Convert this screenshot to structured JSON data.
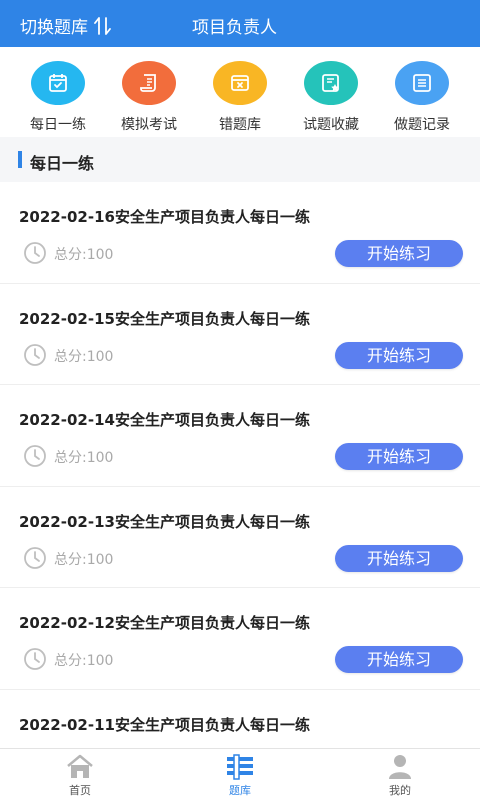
{
  "header": {
    "switch_label": "切换题库",
    "title": "项目负责人"
  },
  "quick_actions": [
    {
      "label": "每日一练",
      "icon": "calendar-check-icon",
      "color": "#25b7f0"
    },
    {
      "label": "模拟考试",
      "icon": "scroll-icon",
      "color": "#f26d3c"
    },
    {
      "label": "错题库",
      "icon": "error-box-icon",
      "color": "#f9b624"
    },
    {
      "label": "试题收藏",
      "icon": "star-doc-icon",
      "color": "#25c3ba"
    },
    {
      "label": "做题记录",
      "icon": "record-list-icon",
      "color": "#4aa2f3"
    }
  ],
  "section": {
    "title": "每日一练"
  },
  "exercises": [
    {
      "title": "2022-02-16安全生产项目负责人每日一练",
      "score": "总分:100",
      "button": "开始练习"
    },
    {
      "title": "2022-02-15安全生产项目负责人每日一练",
      "score": "总分:100",
      "button": "开始练习"
    },
    {
      "title": "2022-02-14安全生产项目负责人每日一练",
      "score": "总分:100",
      "button": "开始练习"
    },
    {
      "title": "2022-02-13安全生产项目负责人每日一练",
      "score": "总分:100",
      "button": "开始练习"
    },
    {
      "title": "2022-02-12安全生产项目负责人每日一练",
      "score": "总分:100",
      "button": "开始练习"
    },
    {
      "title": "2022-02-11安全生产项目负责人每日一练",
      "score": "",
      "button": ""
    }
  ],
  "tabbar": {
    "items": [
      {
        "label": "首页",
        "icon": "home-icon"
      },
      {
        "label": "题库",
        "icon": "question-bank-icon",
        "active": true
      },
      {
        "label": "我的",
        "icon": "user-icon"
      }
    ]
  },
  "colors": {
    "primary": "#2f84e6",
    "button": "#5b7ff0"
  }
}
